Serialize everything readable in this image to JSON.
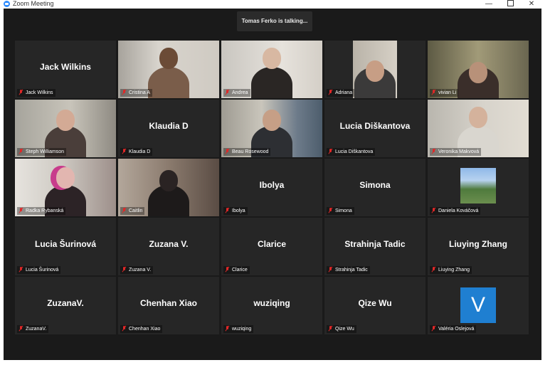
{
  "window": {
    "title": "Zoom Meeting",
    "minimize": "—",
    "maximize": "",
    "close": "✕"
  },
  "speaker_banner": "Tomas Ferko is talking...",
  "tiles": [
    {
      "label": "Jack Wilkins",
      "big_name": "Jack Wilkins",
      "video": false
    },
    {
      "label": "Cristina A",
      "video": true
    },
    {
      "label": "Andrea",
      "video": true
    },
    {
      "label": "Adriana",
      "video": true
    },
    {
      "label": "vivian Li",
      "video": true
    },
    {
      "label": "Steph Williamson",
      "video": true
    },
    {
      "label": "Klaudia D",
      "big_name": "Klaudia D",
      "video": false
    },
    {
      "label": "Beau Rosewood",
      "video": true
    },
    {
      "label": "Lucia Diškantova",
      "big_name": "Lucia Diškantova",
      "video": false
    },
    {
      "label": "Veronika Makvová",
      "video": true
    },
    {
      "label": "Radka Rybanská",
      "video": true
    },
    {
      "label": "Caitlin",
      "video": true
    },
    {
      "label": "Ibolya",
      "big_name": "Ibolya",
      "video": false
    },
    {
      "label": "Simona",
      "big_name": "Simona",
      "video": false
    },
    {
      "label": "Daniela Kováčová",
      "video": false,
      "profile_photo": true
    },
    {
      "label": "Lucia Šurinová",
      "big_name": "Lucia Šurinová",
      "video": false
    },
    {
      "label": "Zuzana V.",
      "big_name": "Zuzana V.",
      "video": false
    },
    {
      "label": "Clarice",
      "big_name": "Clarice",
      "video": false
    },
    {
      "label": "Strahinja Tadic",
      "big_name": "Strahinja Tadic",
      "video": false
    },
    {
      "label": "Liuying Zhang",
      "big_name": "Liuying Zhang",
      "video": false
    },
    {
      "label": "ZuzanaV.",
      "big_name": "ZuzanaV.",
      "video": false
    },
    {
      "label": "Chenhan Xiao",
      "big_name": "Chenhan Xiao",
      "video": false
    },
    {
      "label": "wuziqing",
      "big_name": "wuziqing",
      "video": false
    },
    {
      "label": "Qize Wu",
      "big_name": "Qize Wu",
      "video": false
    },
    {
      "label": "Valéria Oslejová",
      "video": false,
      "avatar_letter": "V"
    }
  ],
  "colors": {
    "stage_bg": "#1a1a1a",
    "tile_bg": "#262626",
    "muted_icon": "#e02828",
    "avatar_blue": "#1f7fd1",
    "zoom_blue": "#2d8cff"
  },
  "icons": {
    "muted": "microphone-muted-icon",
    "app": "zoom-logo-icon"
  }
}
